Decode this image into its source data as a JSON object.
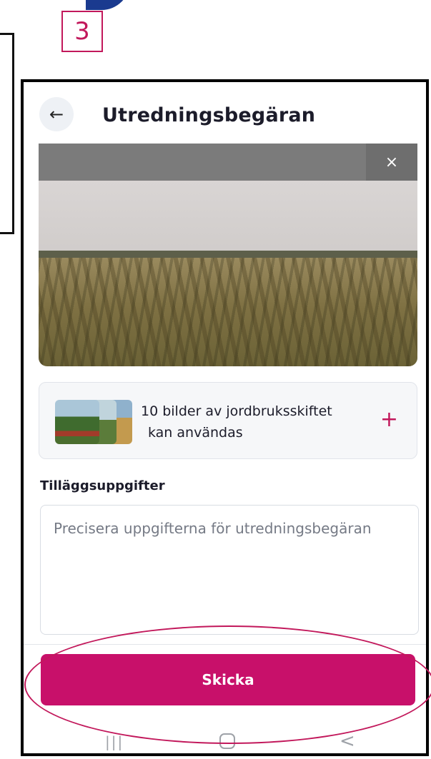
{
  "step": {
    "number": "3"
  },
  "header": {
    "back_icon": "←",
    "title": "Utredningsbegäran"
  },
  "photo": {
    "close_icon": "×"
  },
  "add_photos": {
    "line1": "10 bilder av jordbruksskiftet",
    "line2": "kan användas",
    "plus_icon": "+"
  },
  "additional_info": {
    "label": "Tilläggsuppgifter",
    "placeholder": "Precisera uppgifterna för utredningsbegäran"
  },
  "submit": {
    "label": "Skicka"
  },
  "navbar": {
    "recent_icon": "|||",
    "back_icon": "<"
  },
  "colors": {
    "accent": "#c8106a",
    "badge": "#c2185b"
  }
}
